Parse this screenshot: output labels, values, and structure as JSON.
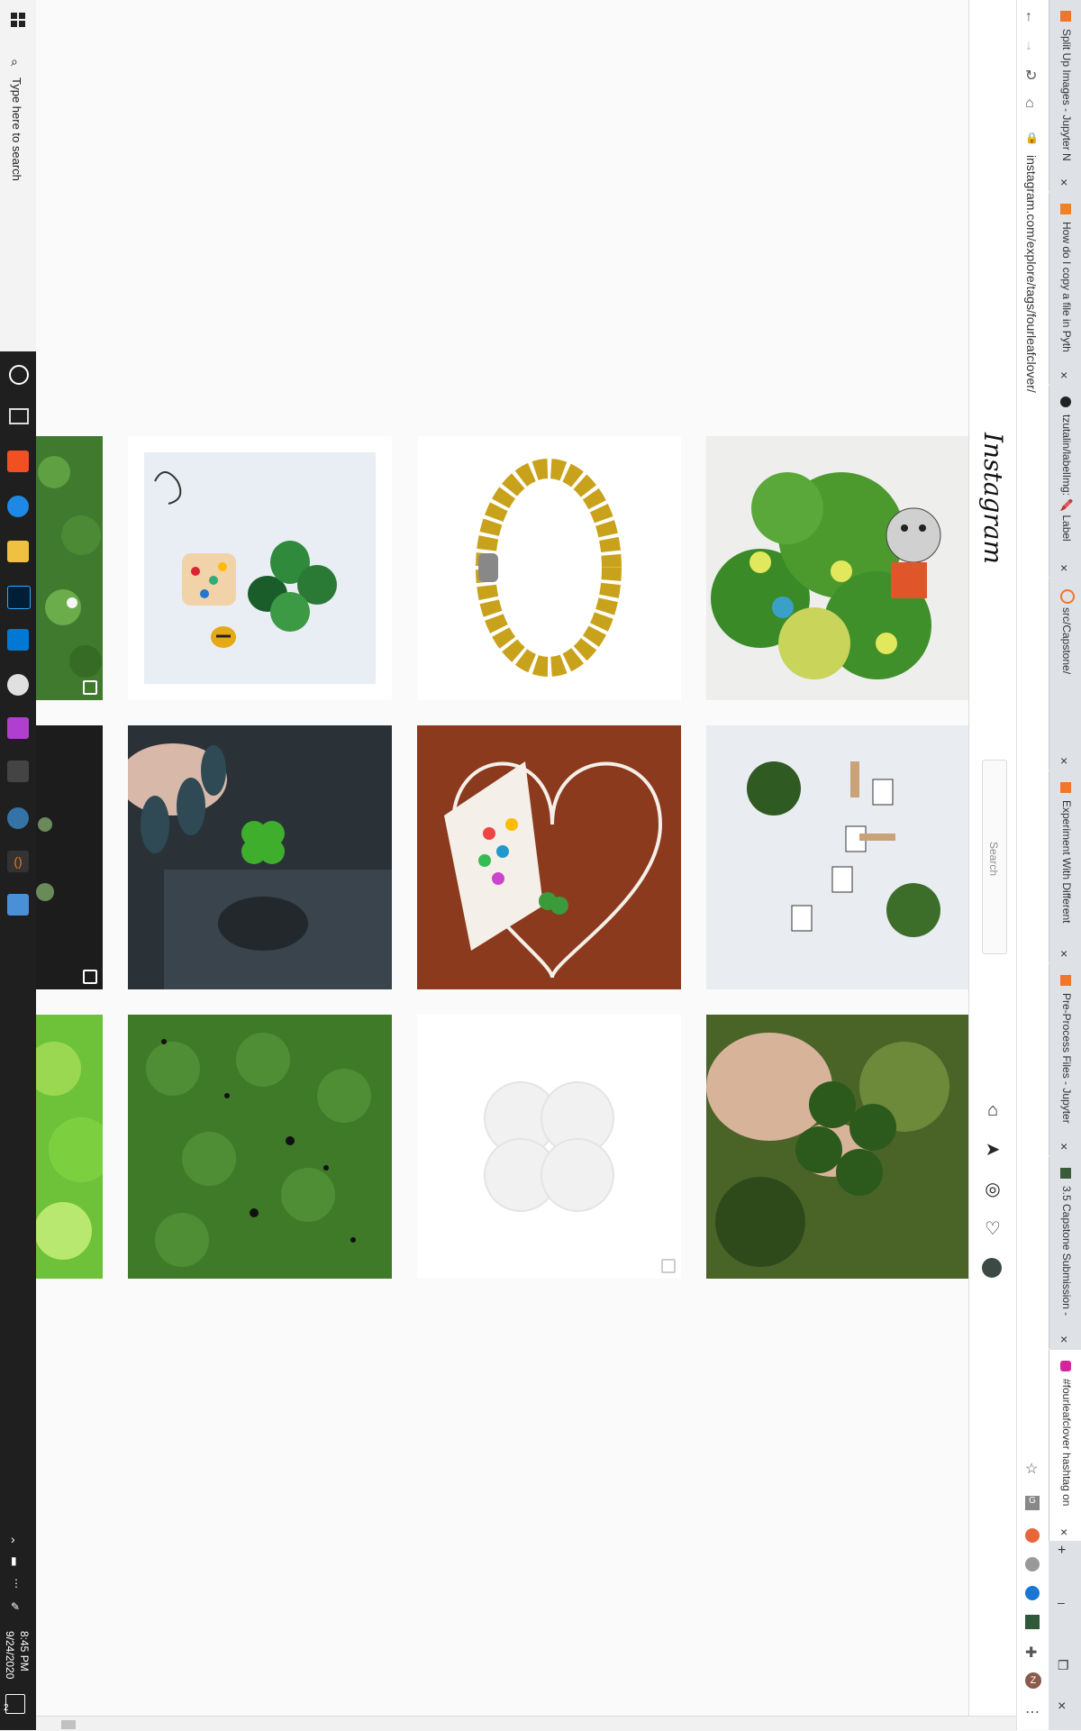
{
  "taskbar": {
    "search_placeholder": "Type here to search",
    "time": "8:45 PM",
    "date": "9/24/2020",
    "notification_count": "2"
  },
  "browser": {
    "url": "instagram.com/explore/tags/fourleafclover/",
    "tabs": [
      {
        "label": "Split Up Images - Jupyter N"
      },
      {
        "label": "How do I copy a file in Pyth"
      },
      {
        "label": "tzutalin/labelImg: 🖍️ Label"
      },
      {
        "label": "src/Capstone/"
      },
      {
        "label": "Experiment With Different"
      },
      {
        "label": "Pre-Process Files - Jupyter"
      },
      {
        "label": "3.5 Capstone Submission -"
      },
      {
        "label": "#fourleafclover hashtag on"
      }
    ]
  },
  "instagram": {
    "logo": "Instagram",
    "search_placeholder": "Search"
  },
  "grid": {
    "tiles": [
      {
        "name": "clover-patch-partial"
      },
      {
        "name": "sea-glass-clover-art"
      },
      {
        "name": "gold-bead-bracelet"
      },
      {
        "name": "clover-mouse-drawing"
      },
      {
        "name": "clover-shirt-partial"
      },
      {
        "name": "clover-in-car-hand"
      },
      {
        "name": "heart-teacup-clover"
      },
      {
        "name": "luck-letters-clovers"
      },
      {
        "name": "bright-clover-partial"
      },
      {
        "name": "green-pattern-clover"
      },
      {
        "name": "white-clover-shape"
      },
      {
        "name": "hand-holding-clover"
      }
    ]
  },
  "colors": {
    "accent": "#0095f6",
    "taskbar": "#1f1f1f",
    "clover_green": "#3a8a2a"
  }
}
